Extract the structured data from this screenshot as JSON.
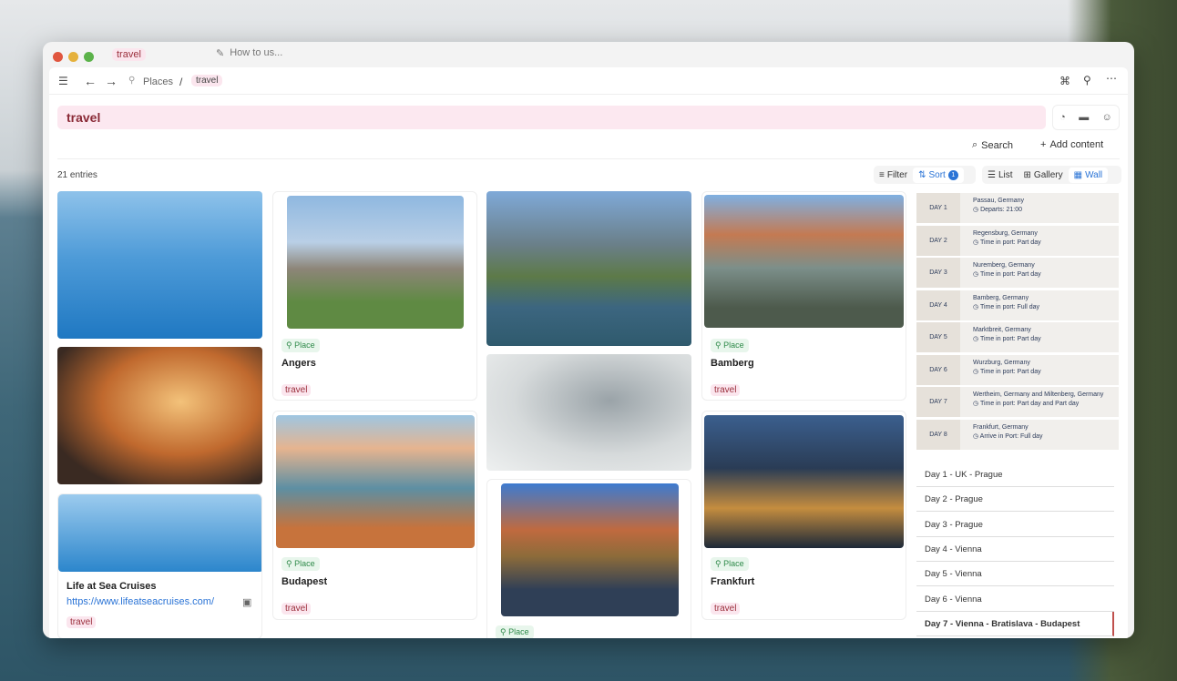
{
  "tabs": [
    {
      "label": "travel"
    },
    {
      "label": "How to us..."
    }
  ],
  "breadcrumb": {
    "parent": "Places",
    "sep": "/",
    "current": "travel"
  },
  "page_title": "travel",
  "toolbar": {
    "search": "Search",
    "add": "Add content"
  },
  "entries": "21 entries",
  "view": {
    "filter": "Filter",
    "sort": "Sort",
    "sort_count": "1",
    "list": "List",
    "gallery": "Gallery",
    "wall": "Wall"
  },
  "cards": {
    "angers": {
      "tag": "Place",
      "title": "Angers",
      "label": "travel"
    },
    "budapest": {
      "tag": "Place",
      "title": "Budapest",
      "label": "travel"
    },
    "bamberg": {
      "tag": "Place",
      "title": "Bamberg",
      "label": "travel"
    },
    "frankfurt": {
      "tag": "Place",
      "title": "Frankfurt",
      "label": "travel"
    },
    "nuremberg": {
      "tag": "Place"
    },
    "cruise": {
      "title": "Life at Sea Cruises",
      "url": "https://www.lifeatseacruises.com/",
      "label": "travel"
    }
  },
  "itinerary": [
    {
      "day": "DAY 1",
      "place": "Passau, Germany",
      "info": "Departs: 21:00"
    },
    {
      "day": "DAY 2",
      "place": "Regensburg, Germany",
      "info": "Time in port: Part day"
    },
    {
      "day": "DAY 3",
      "place": "Nuremberg, Germany",
      "info": "Time in port: Part day"
    },
    {
      "day": "DAY 4",
      "place": "Bamberg, Germany",
      "info": "Time in port: Full day"
    },
    {
      "day": "DAY 5",
      "place": "Marktbreit, Germany",
      "info": "Time in port: Part day"
    },
    {
      "day": "DAY 6",
      "place": "Wurzburg, Germany",
      "info": "Time in port: Part day"
    },
    {
      "day": "DAY 7",
      "place": "Wertheim, Germany and Miltenberg, Germany",
      "info": "Time in port: Part day and Part day"
    },
    {
      "day": "DAY 8",
      "place": "Frankfurt, Germany",
      "info": "Arrive in Port: Full day"
    }
  ],
  "day_list": [
    "Day 1 - UK - Prague",
    "Day 2 - Prague",
    "Day 3 - Prague",
    "Day 4 - Vienna",
    "Day 5 - Vienna",
    "Day 6 - Vienna",
    "Day 7 - Vienna - Bratislava - Budapest"
  ]
}
